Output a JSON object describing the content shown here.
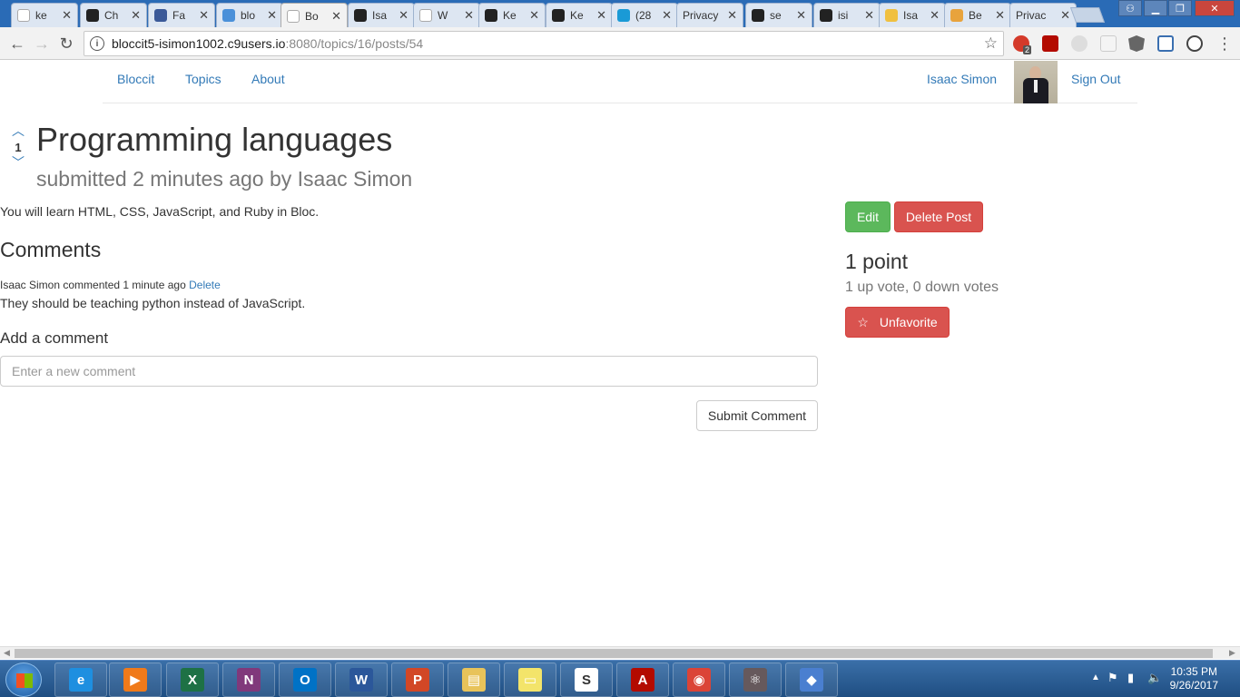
{
  "browser": {
    "tabs": [
      {
        "title": "ke",
        "icon": "google-icon",
        "color": "#ffffff"
      },
      {
        "title": "Ch",
        "icon": "chrome-store-icon",
        "color": "#222222"
      },
      {
        "title": "Fa",
        "icon": "facebook-icon",
        "color": "#3b5998"
      },
      {
        "title": "blo",
        "icon": "eye-icon",
        "color": "#4a90d9"
      },
      {
        "title": "Bo",
        "icon": "page-icon",
        "color": "#ffffff"
      },
      {
        "title": "Isa",
        "icon": "bloc-icon",
        "color": "#222222"
      },
      {
        "title": "W",
        "icon": "page-icon",
        "color": "#ffffff"
      },
      {
        "title": "Ke",
        "icon": "github-icon",
        "color": "#222222"
      },
      {
        "title": "Ke",
        "icon": "github-icon",
        "color": "#222222"
      },
      {
        "title": "(28",
        "icon": "att-icon",
        "color": "#1a9ad6"
      },
      {
        "title": "Privacy",
        "icon": "none",
        "color": "#ffffff"
      },
      {
        "title": "se",
        "icon": "github-icon",
        "color": "#222222"
      },
      {
        "title": "isi",
        "icon": "github-icon",
        "color": "#222222"
      },
      {
        "title": "Isa",
        "icon": "pencil-icon",
        "color": "#f0c040"
      },
      {
        "title": "Be",
        "icon": "rss-icon",
        "color": "#e8a33c"
      },
      {
        "title": "Privac",
        "icon": "none",
        "color": "#ffffff"
      }
    ],
    "url_host": "bloccit5-isimon1002.c9users.io",
    "url_path": ":8080/topics/16/posts/54",
    "ext_badge": "2"
  },
  "nav": {
    "brand": "Bloccit",
    "topics": "Topics",
    "about": "About",
    "user_name": "Isaac Simon",
    "sign_out": "Sign Out"
  },
  "post": {
    "vote_count": "1",
    "title": "Programming languages",
    "submitted": "submitted 2 minutes ago by Isaac Simon",
    "body": "You will learn HTML, CSS, JavaScript, and Ruby in Bloc.",
    "edit_label": "Edit",
    "delete_label": "Delete Post",
    "points": "1 point",
    "votes_detail": "1 up vote, 0 down votes",
    "unfavorite_label": "Unfavorite"
  },
  "comments": {
    "heading": "Comments",
    "items": [
      {
        "meta": "Isaac Simon commented 1 minute ago",
        "delete": "Delete",
        "body": "They should be teaching python instead of JavaScript."
      }
    ],
    "add_heading": "Add a comment",
    "input_placeholder": "Enter a new comment",
    "submit_label": "Submit Comment"
  },
  "taskbar": {
    "apps": [
      {
        "name": "ie-icon",
        "color": "#1e8fe0",
        "glyph": "e"
      },
      {
        "name": "media-player-icon",
        "color": "#f07a1a",
        "glyph": "▶"
      },
      {
        "name": "excel-icon",
        "color": "#1e7145",
        "glyph": "X"
      },
      {
        "name": "onenote-icon",
        "color": "#80397b",
        "glyph": "N"
      },
      {
        "name": "outlook-icon",
        "color": "#0072c6",
        "glyph": "O"
      },
      {
        "name": "word-icon",
        "color": "#2b579a",
        "glyph": "W"
      },
      {
        "name": "powerpoint-icon",
        "color": "#d24726",
        "glyph": "P"
      },
      {
        "name": "file-explorer-icon",
        "color": "#e8c35a",
        "glyph": "▤"
      },
      {
        "name": "sticky-notes-icon",
        "color": "#f3e46a",
        "glyph": "▭"
      },
      {
        "name": "slack-icon",
        "color": "#ffffff",
        "glyph": "S"
      },
      {
        "name": "acrobat-icon",
        "color": "#b30b00",
        "glyph": "A"
      },
      {
        "name": "chrome-icon",
        "color": "#db4437",
        "glyph": "◉"
      },
      {
        "name": "atom-icon",
        "color": "#66595c",
        "glyph": "⚛"
      },
      {
        "name": "git-icon",
        "color": "#4a7fd0",
        "glyph": "◆"
      }
    ],
    "time": "10:35 PM",
    "date": "9/26/2017"
  }
}
